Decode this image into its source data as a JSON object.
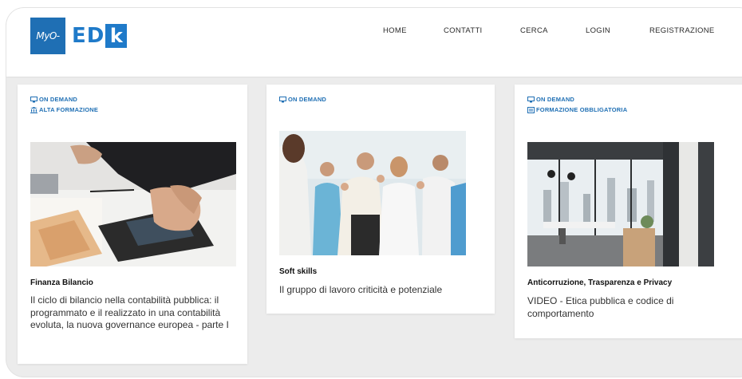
{
  "brand": {
    "logo_left": "MyO-",
    "logo_ed": "ED",
    "logo_k": "k",
    "blue": "#1f6fb4"
  },
  "nav": {
    "items": [
      {
        "label": "HOME"
      },
      {
        "label": "CONTATTI"
      },
      {
        "label": "CERCA"
      },
      {
        "label": "LOGIN"
      },
      {
        "label": "REGISTRAZIONE"
      }
    ]
  },
  "cards": [
    {
      "tags": [
        {
          "icon": "monitor-icon",
          "label": "ON DEMAND"
        },
        {
          "icon": "institution-icon",
          "label": "ALTA FORMAZIONE"
        }
      ],
      "image": "hands-calculator-banknotes-photo",
      "title": "Finanza Bilancio",
      "description": "Il ciclo di bilancio nella contabilità pubblica: il programmato e il realizzato in una contabilità evoluta, la nuova governance europea - parte I"
    },
    {
      "tags": [
        {
          "icon": "monitor-icon",
          "label": "ON DEMAND"
        }
      ],
      "image": "team-thumbs-up-photo",
      "title": "Soft skills",
      "description": "Il gruppo di lavoro criticità e potenziale"
    },
    {
      "tags": [
        {
          "icon": "monitor-icon",
          "label": "ON DEMAND"
        },
        {
          "icon": "checklist-icon",
          "label": "FORMAZIONE OBBLIGATORIA"
        }
      ],
      "image": "office-city-view-photo",
      "title": "Anticorruzione, Trasparenza e Privacy",
      "description": "VIDEO - Etica pubblica e codice di comportamento"
    }
  ]
}
